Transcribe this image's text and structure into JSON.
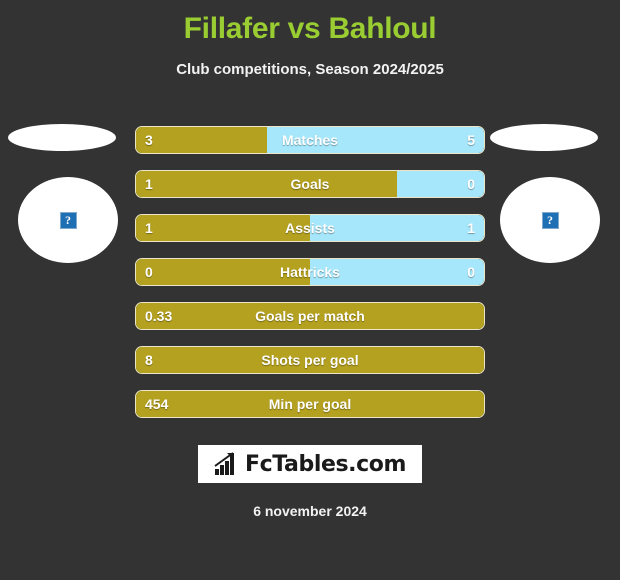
{
  "header": {
    "title": "Fillafer vs Bahloul",
    "subtitle": "Club competitions, Season 2024/2025"
  },
  "colors": {
    "background": "#333333",
    "title_green": "#9ACD32",
    "home_gold": "#B5A120",
    "away_blue": "#A6E7FB",
    "text_white": "#FFFFFF",
    "logo_background": "#FFFFFF"
  },
  "players": {
    "home": {
      "placeholder_icon": "broken-image-icon"
    },
    "away": {
      "placeholder_icon": "broken-image-icon"
    }
  },
  "chart_data": {
    "type": "bar",
    "title": "Fillafer vs Bahloul",
    "subtitle": "Club competitions, Season 2024/2025",
    "orientation": "horizontal-diverging",
    "series": [
      {
        "name": "Fillafer",
        "color": "#B5A120"
      },
      {
        "name": "Bahloul",
        "color": "#A6E7FB"
      }
    ],
    "categories": [
      "Matches",
      "Goals",
      "Assists",
      "Hattricks",
      "Goals per match",
      "Shots per goal",
      "Min per goal"
    ],
    "rows": [
      {
        "label": "Matches",
        "home": "3",
        "away": "5",
        "home_share": 37.5,
        "two_sided": true
      },
      {
        "label": "Goals",
        "home": "1",
        "away": "0",
        "home_share": 75.0,
        "two_sided": true
      },
      {
        "label": "Assists",
        "home": "1",
        "away": "1",
        "home_share": 50.0,
        "two_sided": true
      },
      {
        "label": "Hattricks",
        "home": "0",
        "away": "0",
        "home_share": 50.0,
        "two_sided": true
      },
      {
        "label": "Goals per match",
        "home": "0.33",
        "away": "",
        "home_share": 100.0,
        "two_sided": false
      },
      {
        "label": "Shots per goal",
        "home": "8",
        "away": "",
        "home_share": 100.0,
        "two_sided": false
      },
      {
        "label": "Min per goal",
        "home": "454",
        "away": "",
        "home_share": 100.0,
        "two_sided": false
      }
    ]
  },
  "logo": {
    "text": "FcTables.com",
    "icon": "bar-chart-growth-icon"
  },
  "footer": {
    "date": "6 november 2024"
  }
}
